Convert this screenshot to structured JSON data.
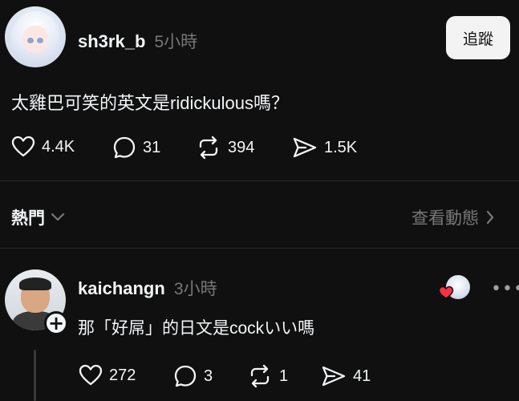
{
  "post": {
    "username": "sh3rk_b",
    "time": "5小時",
    "follow_label": "追蹤",
    "text_cjk": "太雞巴可笑的英文是",
    "text_latin": "ridickulous",
    "text_suffix": "嗎？",
    "likes": "4.4K",
    "comments": "31",
    "reposts": "394",
    "shares": "1.5K"
  },
  "section": {
    "left_label": "熱門",
    "right_label": "查看動態"
  },
  "reply": {
    "username": "kaichangn",
    "time": "3小時",
    "text_pre": "那「好屌」的日文是",
    "text_latin": "cock",
    "text_post": "いい嗎",
    "likes": "272",
    "comments": "3",
    "reposts": "1",
    "shares": "41"
  },
  "icons": {
    "like": "heart-icon",
    "comment": "comment-bubble-icon",
    "repost": "repost-icon",
    "share": "send-icon",
    "chevron": "chevron-down-icon",
    "more": "more-horizontal-icon"
  },
  "colors": {
    "background": "#101010",
    "text": "#f3f5f7",
    "muted": "#777777",
    "like_heart": "#ff3040"
  }
}
